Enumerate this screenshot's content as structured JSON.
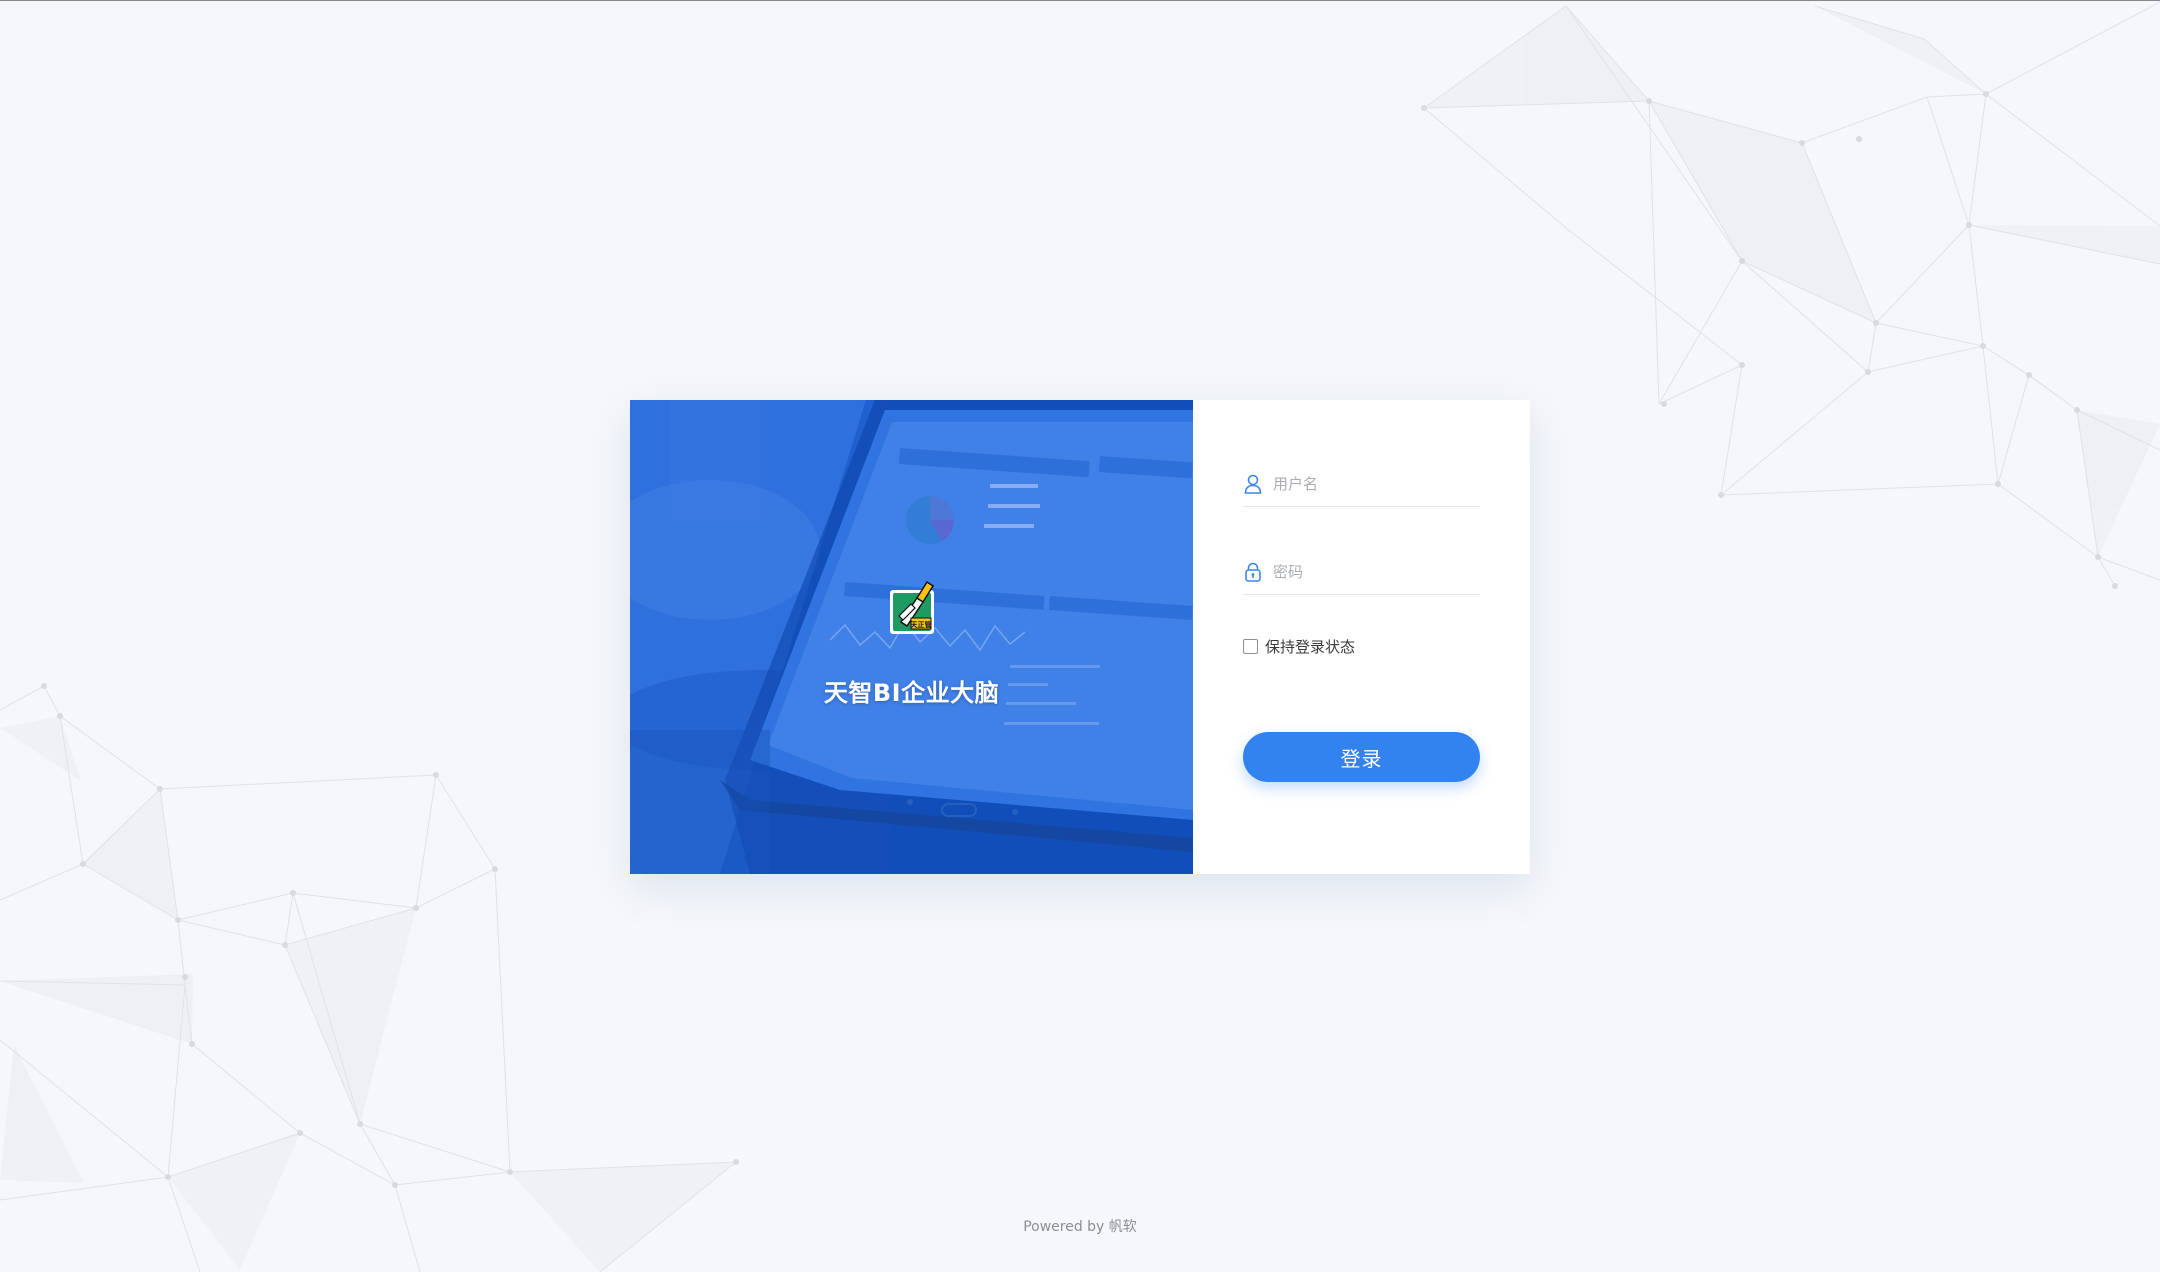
{
  "brand": {
    "title": "天智BI企业大脑",
    "logo_badge_text": "天正管"
  },
  "form": {
    "username": {
      "placeholder": "用户名",
      "value": "",
      "icon": "user-icon"
    },
    "password": {
      "placeholder": "密码",
      "value": "",
      "icon": "lock-icon"
    },
    "remember": {
      "label": "保持登录状态",
      "checked": false
    },
    "submit_label": "登录"
  },
  "footer": {
    "text": "Powered by 帆软"
  },
  "colors": {
    "page_background": "#f5f7fa",
    "accent": "#3283f0",
    "panel_overlay": "#1f63d6"
  }
}
